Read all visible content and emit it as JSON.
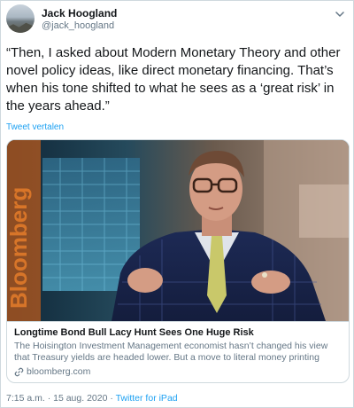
{
  "author": {
    "name": "Jack Hoogland",
    "handle": "@jack_hoogland"
  },
  "tweet": {
    "text": "“Then, I asked about Modern Monetary Theory and other novel policy ideas, like direct monetary financing. That’s when his tone shifted to what he sees as a ‘great risk’ in the years ahead.”",
    "translate_label": "Tweet vertalen"
  },
  "card": {
    "photo_brand_text": "Bloomberg",
    "title": "Longtime Bond Bull Lacy Hunt Sees One Huge Risk",
    "description": "The Hoisington Investment Management economist hasn’t changed his view that Treasury yields are headed lower. But a move to literal money printing could ...",
    "domain": "bloomberg.com"
  },
  "meta": {
    "time": "7:15 a.m.",
    "separator": "·",
    "date": "15 aug. 2020",
    "source": "Twitter for iPad"
  },
  "icons": {
    "more": "chevron-down-icon",
    "link": "link-icon"
  },
  "colors": {
    "link_blue": "#1da1f2",
    "secondary_text": "#657786",
    "border": "#cfd9de"
  }
}
